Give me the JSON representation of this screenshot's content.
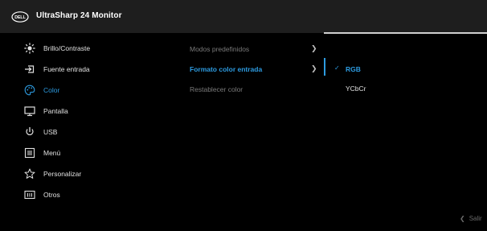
{
  "header": {
    "logo_text": "DELL",
    "title": "UltraSharp 24 Monitor"
  },
  "menu": {
    "items": [
      {
        "label": "Brillo/Contraste",
        "icon": "brightness-icon"
      },
      {
        "label": "Fuente entrada",
        "icon": "input-source-icon"
      },
      {
        "label": "Color",
        "icon": "color-palette-icon",
        "active": true
      },
      {
        "label": "Pantalla",
        "icon": "display-icon"
      },
      {
        "label": "USB",
        "icon": "usb-icon"
      },
      {
        "label": "Menú",
        "icon": "menu-icon"
      },
      {
        "label": "Personalizar",
        "icon": "star-icon"
      },
      {
        "label": "Otros",
        "icon": "others-icon"
      }
    ]
  },
  "submenu": {
    "items": [
      {
        "label": "Modos predefinidos",
        "has_chevron": true
      },
      {
        "label": "Formato color entrada",
        "has_chevron": true,
        "active": true
      },
      {
        "label": "Restablecer color",
        "has_chevron": false
      }
    ]
  },
  "options": {
    "items": [
      {
        "label": "RGB",
        "selected": true
      },
      {
        "label": "YCbCr",
        "selected": false
      }
    ]
  },
  "footer": {
    "exit_label": "Salir",
    "exit_icon": "chevron-left-icon"
  },
  "colors": {
    "background": "#000000",
    "header": "#1e1e1e",
    "accent": "#2d9be0",
    "text": "#e0e0e0",
    "muted": "#7a7a7a"
  }
}
